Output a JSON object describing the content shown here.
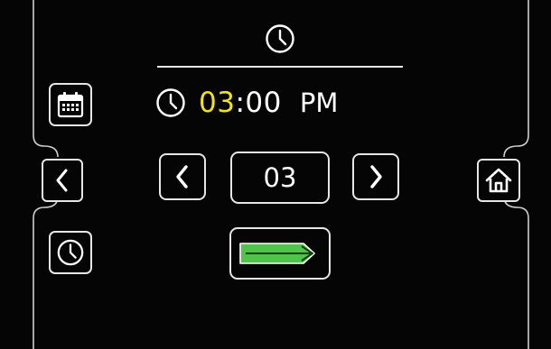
{
  "header": {
    "icon": "clock-icon"
  },
  "time_display": {
    "hour": "03",
    "separator": ":",
    "minutes": "00",
    "period": "PM"
  },
  "stepper": {
    "value": "03",
    "decrement_icon": "chevron-left-icon",
    "increment_icon": "chevron-right-icon"
  },
  "sidebar_left": [
    {
      "icon": "calendar-icon"
    },
    {
      "icon": "chevron-left-icon"
    },
    {
      "icon": "clock-icon"
    }
  ],
  "sidebar_right": [
    {
      "icon": "home-icon"
    }
  ],
  "confirm": {
    "icon": "arrow-right-icon",
    "color": "#4fc34a"
  },
  "colors": {
    "background": "#050505",
    "accent": "#f0e21e",
    "line": "#e6e6e6"
  }
}
